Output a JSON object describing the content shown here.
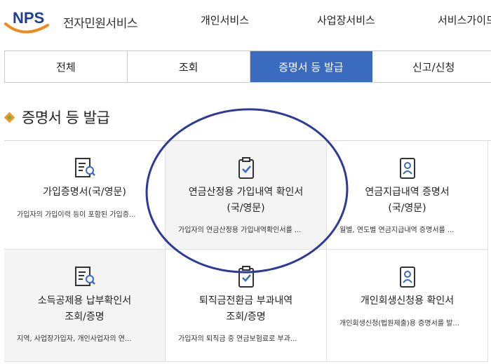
{
  "header": {
    "logo_mark": "NPS",
    "logo_text": "전자민원서비스",
    "nav": [
      "개인서비스",
      "사업장서비스",
      "서비스가이드"
    ]
  },
  "tabs": [
    {
      "label": "전체",
      "active": false
    },
    {
      "label": "조회",
      "active": false
    },
    {
      "label": "증명서 등 발급",
      "active": true
    },
    {
      "label": "신고/신청",
      "active": false
    }
  ],
  "section": {
    "title": "증명서 등 발급"
  },
  "cards": [
    {
      "title1": "가입증명서(국/영문)",
      "title2": "",
      "desc": "가입자의 가입이력 등이 포함된 가입증...",
      "icon": "document-search-icon"
    },
    {
      "title1": "연금산정용 가입내역 확인서",
      "title2": "(국/영문)",
      "desc": "가입자의 연금산정용 가입내역확인서를 ...",
      "icon": "clipboard-check-icon"
    },
    {
      "title1": "연금지급내역 증명서",
      "title2": "(국/영문)",
      "desc": "월별, 연도별 연금지급내역 증명서를 ...",
      "icon": "id-card-person-icon"
    },
    {
      "title1": "소득공제용 납부확인서",
      "title2": "조회/증명",
      "desc": "지역, 사업장가입자, 개인사업자의 연...",
      "icon": "document-search-icon"
    },
    {
      "title1": "퇴직금전환금 부과내역",
      "title2": "조회/증명",
      "desc": "가입자의 퇴직금 중 연금보험료로 부과...",
      "icon": "clipboard-check-icon"
    },
    {
      "title1": "개인회생신청용 확인서",
      "title2": "",
      "desc": "개인회생신청(법원제출)용 증명서를 발...",
      "icon": "id-card-person-icon"
    }
  ],
  "colors": {
    "active_tab": "#3a6bbf",
    "annotation": "#2e3a9a",
    "diamond_outer": "#f39a1d",
    "diamond_inner": "#6bb33a",
    "logo_blue": "#1f3f95",
    "logo_orange": "#f08a1c"
  }
}
